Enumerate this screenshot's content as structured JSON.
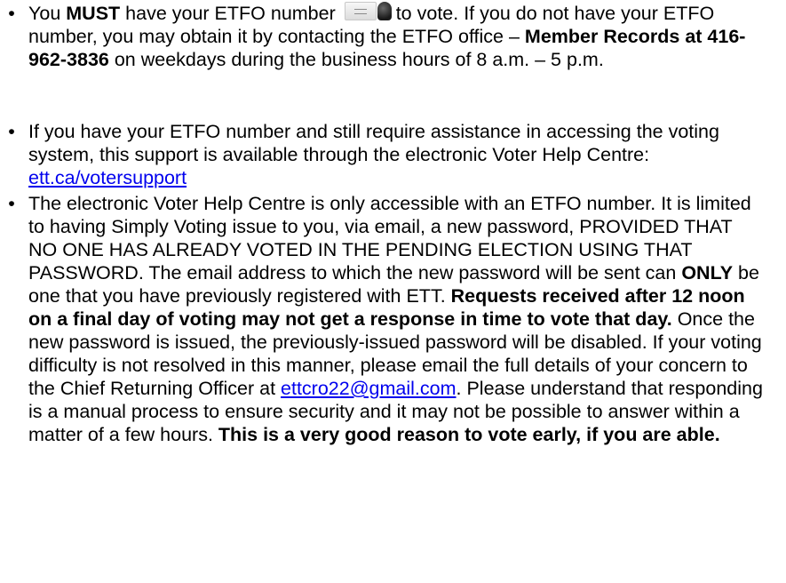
{
  "bullets": {
    "glyph": "•",
    "item1": {
      "t1": "You ",
      "b1": "MUST",
      "t2": " have your ETFO number ",
      "t3": " to vote.  If you do not have your ETFO number, you may obtain it by contacting the ETFO office – ",
      "b2": "Member Records at 416-962-3836",
      "t4": " on weekdays during the business hours of 8 a.m. – 5 p.m.",
      "icon": "member-card-icon"
    },
    "item2": {
      "t1": "If you have your ETFO number and still require assistance in accessing the voting system, this support is available through the electronic Voter Help Centre: ",
      "link": "ett.ca/votersupport"
    },
    "item3": {
      "t1": "The electronic Voter Help Centre is only accessible with an ETFO number.  It is limited to having Simply Voting issue to you, via email, a new password, PROVIDED THAT NO ONE HAS ALREADY VOTED IN THE PENDING ELECTION USING THAT PASSWORD. The email address to which the new password will be sent can ",
      "b1": "ONLY",
      "t2": " be one that you have previously registered with ETT. ",
      "b2": "Requests received after 12 noon on a final day of voting may not get a response in time to vote that day.",
      "t3": " Once the new password is issued, the previously-issued password will be disabled. If your voting difficulty is not resolved in this manner, please email the full details of your concern to the Chief Returning Officer at ",
      "link": "ettcro22@gmail.com",
      "t4": ".  Please understand that responding is a manual process to ensure security and it may not be possible to answer within a matter of a few hours. ",
      "b3": "This is a very good reason to vote early, if you are able."
    }
  },
  "colors": {
    "text": "#000000",
    "link": "#0000ee",
    "background": "#ffffff"
  }
}
